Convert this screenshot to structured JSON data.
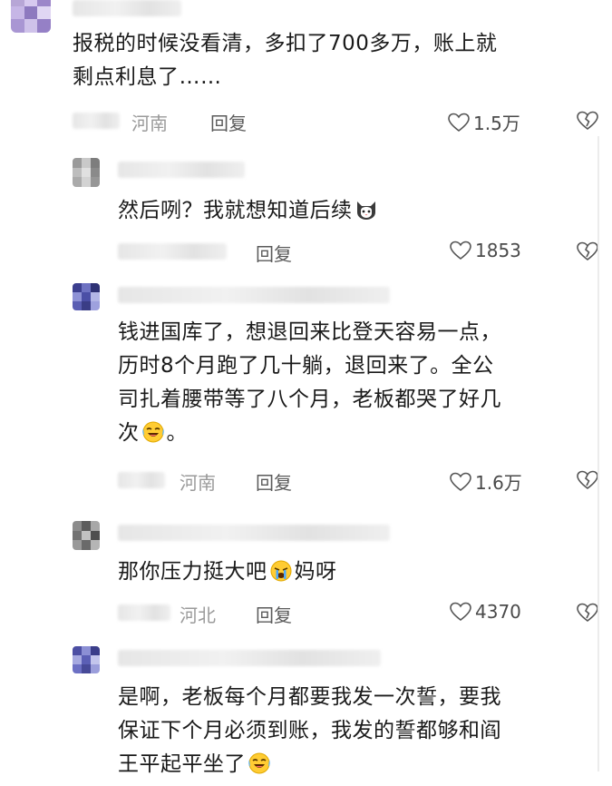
{
  "comments": [
    {
      "text_lines": [
        "报税的时候没看清，多扣了700多万，账上就",
        "剩点利息了……"
      ],
      "location": "河南",
      "reply_label": "回复",
      "likes": "1.5万",
      "avatar_colors": [
        "#b7a6d6",
        "#d7c9ef",
        "#9c86c9",
        "#c6b6e6",
        "#8d79bf",
        "#e0d6f3",
        "#a996d3",
        "#cfc2ea",
        "#9580c6"
      ]
    },
    {
      "text_lines": [
        "然后咧？我就想知道后续"
      ],
      "location": "",
      "reply_label": "回复",
      "likes": "1853",
      "emoji_after_text": "cat-face-emoji",
      "avatar_colors": [
        "#9a9a9a",
        "#c9c9c9",
        "#7d7d7d",
        "#bdbdbd",
        "#e0e0e0",
        "#8a8a8a",
        "#aaaaaa",
        "#d3d3d3",
        "#969696"
      ]
    },
    {
      "text_lines": [
        "钱进国库了，想退回来比登天容易一点，",
        "历时8个月跑了几十躺，退回来了。全公",
        "司扎着腰带等了八个月，老板都哭了好几",
        "次"
      ],
      "text_tail": "。",
      "location": "河南",
      "reply_label": "回复",
      "likes": "1.6万",
      "emoji_after_text": "laughing-crying-emoji",
      "avatar_colors": [
        "#3c3f8f",
        "#6e72c2",
        "#2f3275",
        "#8e92d6",
        "#4b4fa6",
        "#b3b6e6",
        "#5a5eb3",
        "#3a3d86",
        "#9ea1de"
      ]
    },
    {
      "text_lines": [
        "那你压力挺大吧",
        "妈呀"
      ],
      "location": "河北",
      "reply_label": "回复",
      "likes": "4370",
      "emoji_after_text": "crying-emoji",
      "avatar_colors": [
        "#8c8c8c",
        "#5d5d5d",
        "#a8a8a8",
        "#737373",
        "#c2c2c2",
        "#4f4f4f",
        "#999999",
        "#6a6a6a",
        "#b5b5b5"
      ]
    },
    {
      "text_lines": [
        "是啊，老板每个月都要我发一次誓，要我",
        "保证下个月必须到账，我发的誓都够和阎",
        "王平起平坐了"
      ],
      "emoji_after_text": "laughing-crying-emoji",
      "avatar_colors": [
        "#4c4fa3",
        "#8b8fd4",
        "#3b3e8a",
        "#a6a9e0",
        "#5b5fb5",
        "#c3c5ec",
        "#6c70c4",
        "#474a98",
        "#9b9edb"
      ]
    }
  ],
  "colors": {
    "text": "#1a1a1a",
    "meta": "#9a9a9a",
    "reply": "#5a5a5a"
  }
}
